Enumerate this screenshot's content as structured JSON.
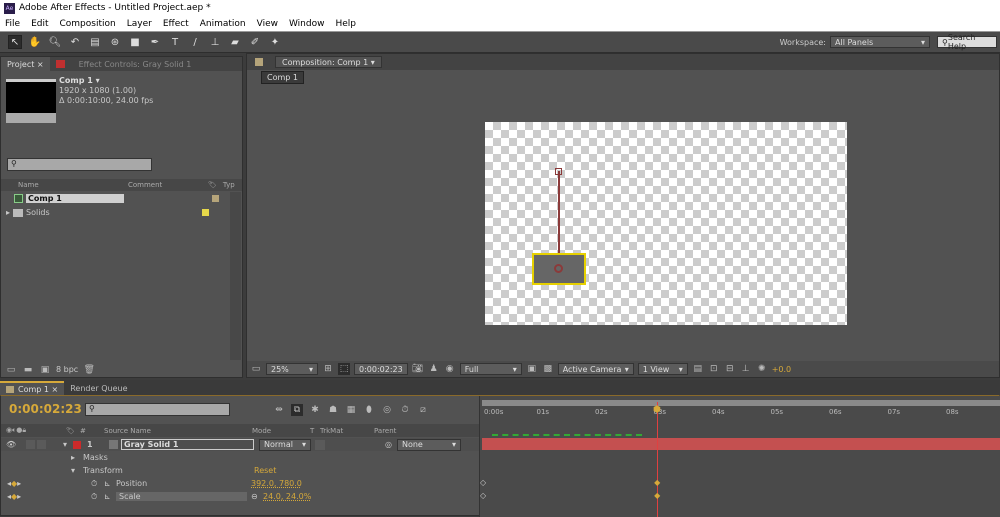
{
  "window": {
    "title": "Adobe After Effects - Untitled Project.aep *",
    "logo": "Ae"
  },
  "menu": [
    "File",
    "Edit",
    "Composition",
    "Layer",
    "Effect",
    "Animation",
    "View",
    "Window",
    "Help"
  ],
  "toolbar": {
    "workspace_label": "Workspace:",
    "workspace_value": "All Panels",
    "search_help": "Search Help"
  },
  "project_panel": {
    "tab_project": "Project",
    "tab_effect": "Effect Controls: Gray Solid 1",
    "comp_name": "Comp 1 ▾",
    "comp_size": "1920 x 1080 (1.00)",
    "comp_duration": "Δ 0:00:10:00, 24.00 fps",
    "search_placeholder": "",
    "columns": [
      "Name",
      "Comment",
      "Typ"
    ],
    "items": [
      {
        "name": "Comp 1",
        "label_color": "#b5a47a"
      },
      {
        "name": "Solids",
        "label_color": "#e6d84a"
      }
    ],
    "bpc": "8 bpc"
  },
  "comp_panel": {
    "tab": "Composition: Comp 1",
    "breadcrumb": "Comp 1",
    "zoom": "25%",
    "timecode": "0:00:02:23",
    "resolution": "Full",
    "camera": "Active Camera",
    "views": "1 View",
    "exposure": "+0.0"
  },
  "timeline": {
    "tab_comp": "Comp 1",
    "tab_render": "Render Queue",
    "timecode": "0:00:02:23",
    "columns": {
      "num": "#",
      "source": "Source Name",
      "mode": "Mode",
      "t": "T",
      "trkmat": "TrkMat",
      "parent": "Parent"
    },
    "layer": {
      "num": "1",
      "name": "Gray Solid 1",
      "mode": "Normal",
      "parent": "None",
      "color": "#cc2a2a"
    },
    "masks": "Masks",
    "transform": "Transform",
    "reset": "Reset",
    "props": [
      {
        "name": "Position",
        "value": "392.0, 780.0"
      },
      {
        "name": "Scale",
        "value": "24.0, 24.0%"
      }
    ],
    "ruler": [
      "0:00s",
      "01s",
      "02s",
      "03s",
      "04s",
      "05s",
      "06s",
      "07s",
      "08s"
    ],
    "current_time_seconds": 2.96
  },
  "colors": {
    "accent": "#d6a93a",
    "layer_bar": "#c45050",
    "playhead": "#e04040"
  }
}
